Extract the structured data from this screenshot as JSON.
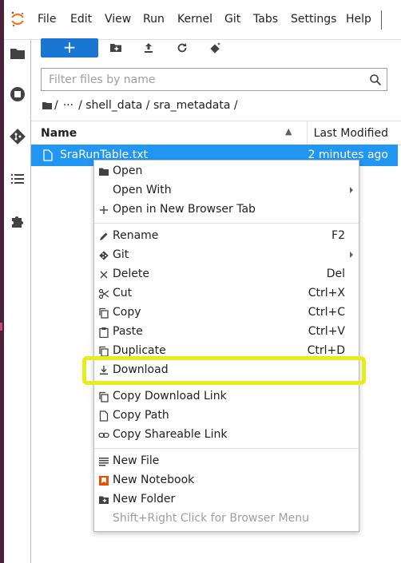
{
  "menubar": {
    "items": [
      "File",
      "Edit",
      "View",
      "Run",
      "Kernel",
      "Git",
      "Tabs",
      "Settings",
      "Help"
    ]
  },
  "leftbar": {
    "icons": [
      "folder-icon",
      "running-icon",
      "git-icon",
      "toc-icon",
      "extension-icon"
    ]
  },
  "toolbar": {
    "new_label": "+",
    "icons": [
      "new-folder-icon",
      "upload-icon",
      "refresh-icon",
      "git-clone-icon"
    ]
  },
  "search": {
    "placeholder": "Filter files by name"
  },
  "breadcrumb": {
    "parts": [
      "/",
      "···",
      "/ shell_data / sra_metadata /"
    ]
  },
  "file_list": {
    "col_name": "Name",
    "col_modified": "Last Modified",
    "rows": [
      {
        "name": "SraRunTable.txt",
        "modified": "2 minutes ago"
      }
    ]
  },
  "context_menu": {
    "open": "Open",
    "open_with": "Open With",
    "open_new_tab": "Open in New Browser Tab",
    "rename": "Rename",
    "rename_sc": "F2",
    "git": "Git",
    "delete": "Delete",
    "delete_sc": "Del",
    "cut": "Cut",
    "cut_sc": "Ctrl+X",
    "copy": "Copy",
    "copy_sc": "Ctrl+C",
    "paste": "Paste",
    "paste_sc": "Ctrl+V",
    "duplicate": "Duplicate",
    "duplicate_sc": "Ctrl+D",
    "download": "Download",
    "copy_download_link": "Copy Download Link",
    "copy_path": "Copy Path",
    "copy_shareable_link": "Copy Shareable Link",
    "new_file": "New File",
    "new_notebook": "New Notebook",
    "new_folder": "New Folder",
    "browser_menu_hint": "Shift+Right Click for Browser Menu"
  },
  "colors": {
    "accent": "#1976d2",
    "selection": "#2196f3",
    "highlight": "#e6ee1a",
    "notebook_icon": "#e65100"
  }
}
